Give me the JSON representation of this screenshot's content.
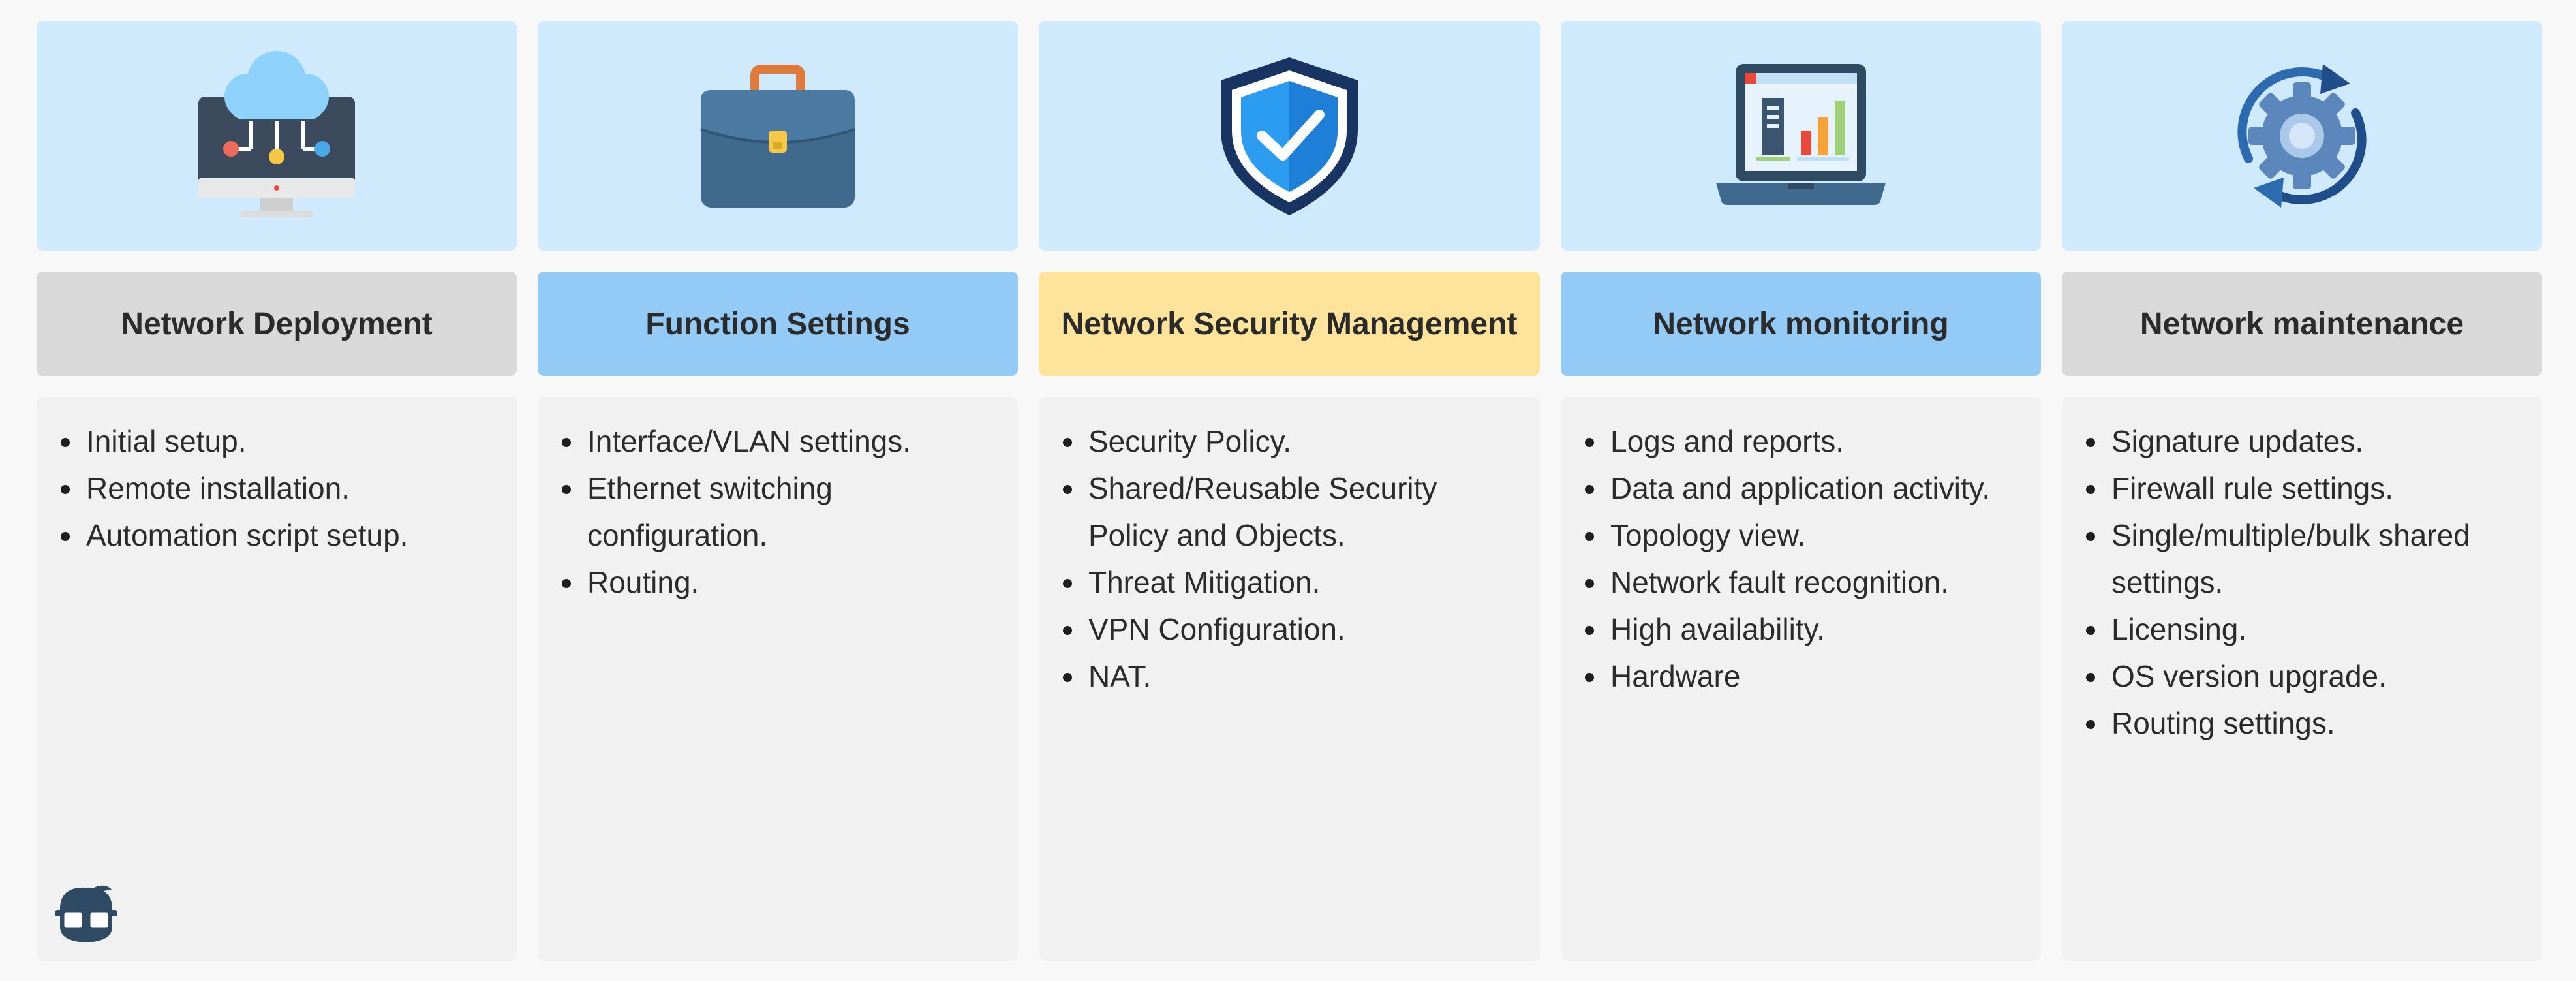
{
  "columns": [
    {
      "icon": "cloud-computer-icon",
      "title": "Network Deployment",
      "items": [
        "Initial setup.",
        "Remote installation.",
        "Automation script setup."
      ]
    },
    {
      "icon": "briefcase-icon",
      "title": "Function Settings",
      "items": [
        "Interface/VLAN settings.",
        "Ethernet switching configuration.",
        "Routing."
      ]
    },
    {
      "icon": "shield-check-icon",
      "title": "Network Security Management",
      "items": [
        "Security Policy.",
        "Shared/Reusable Security Policy and Objects.",
        "Threat Mitigation.",
        "VPN Configuration.",
        "NAT."
      ]
    },
    {
      "icon": "laptop-chart-icon",
      "title": "Network monitoring",
      "items": [
        "Logs and reports.",
        "Data and application activity.",
        "Topology view.",
        "Network fault recognition.",
        "High availability.",
        "Hardware"
      ]
    },
    {
      "icon": "gear-refresh-icon",
      "title": "Network maintenance",
      "items": [
        "Signature updates.",
        "Firewall rule settings.",
        "Single/multiple/bulk shared settings.",
        "Licensing.",
        "OS version upgrade.",
        "Routing settings."
      ]
    }
  ],
  "colors": {
    "icon_background": "#d0eafd",
    "header_gray": "#d9d9d9",
    "header_blue": "#93cbf6",
    "header_yellow": "#fde49a",
    "content_background": "#f1f1f1"
  },
  "logo_icon": "nerd-mascot-icon"
}
